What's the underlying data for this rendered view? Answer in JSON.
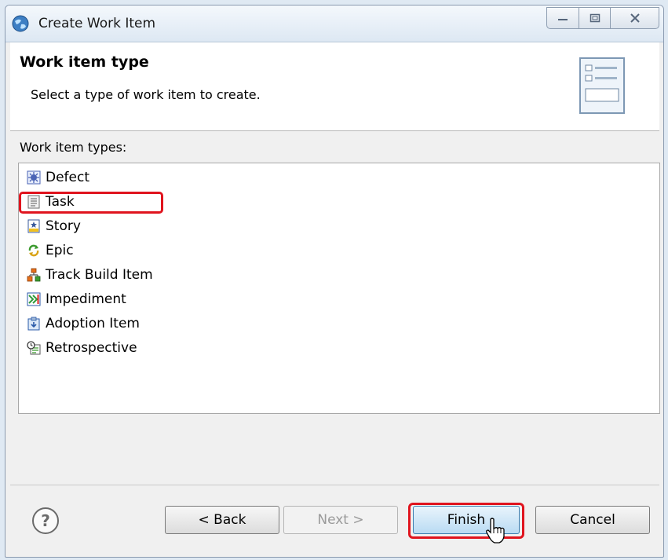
{
  "window": {
    "title": "Create Work Item",
    "controls": {
      "minimize_icon": "minimize-icon",
      "maximize_icon": "maximize-icon",
      "close_icon": "close-icon"
    }
  },
  "header": {
    "title": "Work item type",
    "description": "Select a type of work item to create."
  },
  "list": {
    "label": "Work item types:",
    "selected": "Task",
    "items": [
      {
        "label": "Defect",
        "icon": "defect-icon"
      },
      {
        "label": "Task",
        "icon": "task-icon"
      },
      {
        "label": "Story",
        "icon": "story-icon"
      },
      {
        "label": "Epic",
        "icon": "epic-icon"
      },
      {
        "label": "Track Build Item",
        "icon": "track-build-item-icon"
      },
      {
        "label": "Impediment",
        "icon": "impediment-icon"
      },
      {
        "label": "Adoption Item",
        "icon": "adoption-item-icon"
      },
      {
        "label": "Retrospective",
        "icon": "retrospective-icon"
      }
    ]
  },
  "footer": {
    "help_symbol": "?",
    "back_label": "< Back",
    "next_label": "Next >",
    "finish_label": "Finish",
    "cancel_label": "Cancel",
    "next_enabled": false
  },
  "colors": {
    "highlight": "#e0141e",
    "primary_button": "#b9dbf3"
  }
}
